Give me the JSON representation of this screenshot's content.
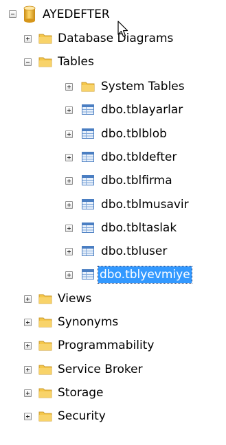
{
  "tree": {
    "root": {
      "label": "AYEDEFTER",
      "icon": "database-icon",
      "expanded": true
    },
    "children": [
      {
        "label": "Database Diagrams",
        "icon": "folder-icon",
        "expanded": false
      },
      {
        "label": "Tables",
        "icon": "folder-icon",
        "expanded": true,
        "children": [
          {
            "label": "System Tables",
            "icon": "folder-icon"
          },
          {
            "label": "dbo.tblayarlar",
            "icon": "table-icon"
          },
          {
            "label": "dbo.tblblob",
            "icon": "table-icon"
          },
          {
            "label": "dbo.tbldefter",
            "icon": "table-icon"
          },
          {
            "label": "dbo.tblfirma",
            "icon": "table-icon"
          },
          {
            "label": "dbo.tblmusavir",
            "icon": "table-icon"
          },
          {
            "label": "dbo.tbltaslak",
            "icon": "table-icon"
          },
          {
            "label": "dbo.tbluser",
            "icon": "table-icon"
          },
          {
            "label": "dbo.tblyevmiye",
            "icon": "table-icon",
            "selected": true
          }
        ]
      },
      {
        "label": "Views",
        "icon": "folder-icon",
        "expanded": false
      },
      {
        "label": "Synonyms",
        "icon": "folder-icon",
        "expanded": false
      },
      {
        "label": "Programmability",
        "icon": "folder-icon",
        "expanded": false
      },
      {
        "label": "Service Broker",
        "icon": "folder-icon",
        "expanded": false
      },
      {
        "label": "Storage",
        "icon": "folder-icon",
        "expanded": false
      },
      {
        "label": "Security",
        "icon": "folder-icon",
        "expanded": false
      }
    ]
  },
  "colors": {
    "selection": "#3399ff",
    "folder": "#f5c74a",
    "database": "#e8a41a",
    "table": "#4a7ec2"
  }
}
